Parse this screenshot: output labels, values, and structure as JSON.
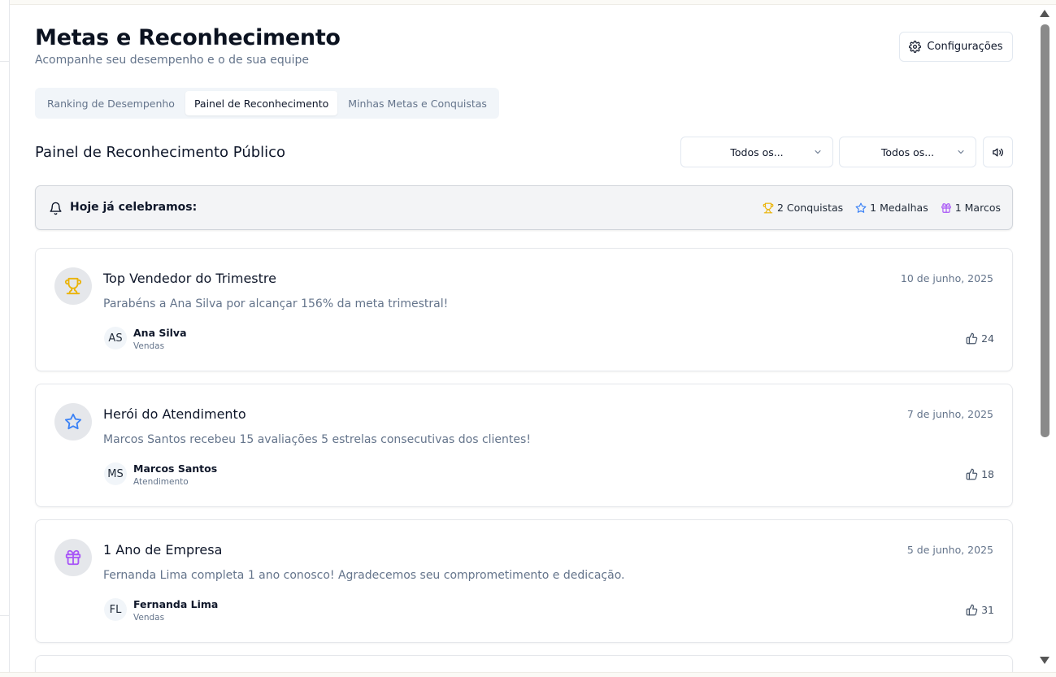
{
  "header": {
    "title": "Metas e Reconhecimento",
    "subtitle": "Acompanhe seu desempenho e o de sua equipe",
    "config_label": "Configurações"
  },
  "tabs": [
    {
      "label": "Ranking de Desempenho",
      "active": false
    },
    {
      "label": "Painel de Reconhecimento",
      "active": true
    },
    {
      "label": "Minhas Metas e Conquistas",
      "active": false
    }
  ],
  "section": {
    "title": "Painel de Reconhecimento Público",
    "filter1": "Todos os...",
    "filter2": "Todos os..."
  },
  "celebration": {
    "title": "Hoje já celebramos:",
    "stats": [
      {
        "label": "2 Conquistas",
        "icon": "trophy-icon",
        "color": "#eab308"
      },
      {
        "label": "1 Medalhas",
        "icon": "star-icon",
        "color": "#3b82f6"
      },
      {
        "label": "1 Marcos",
        "icon": "gift-icon",
        "color": "#a855f7"
      }
    ]
  },
  "cards": [
    {
      "icon": "trophy-icon",
      "icon_color": "#eab308",
      "title": "Top Vendedor do Trimestre",
      "date": "10 de junho, 2025",
      "description": "Parabéns a Ana Silva por alcançar 156% da meta trimestral!",
      "initials": "AS",
      "name": "Ana Silva",
      "department": "Vendas",
      "likes": "24"
    },
    {
      "icon": "star-icon",
      "icon_color": "#3b82f6",
      "title": "Herói do Atendimento",
      "date": "7 de junho, 2025",
      "description": "Marcos Santos recebeu 15 avaliações 5 estrelas consecutivas dos clientes!",
      "initials": "MS",
      "name": "Marcos Santos",
      "department": "Atendimento",
      "likes": "18"
    },
    {
      "icon": "gift-icon",
      "icon_color": "#a855f7",
      "title": "1 Ano de Empresa",
      "date": "5 de junho, 2025",
      "description": "Fernanda Lima completa 1 ano conosco! Agradecemos seu comprometimento e dedicação.",
      "initials": "FL",
      "name": "Fernanda Lima",
      "department": "Vendas",
      "likes": "31"
    }
  ]
}
